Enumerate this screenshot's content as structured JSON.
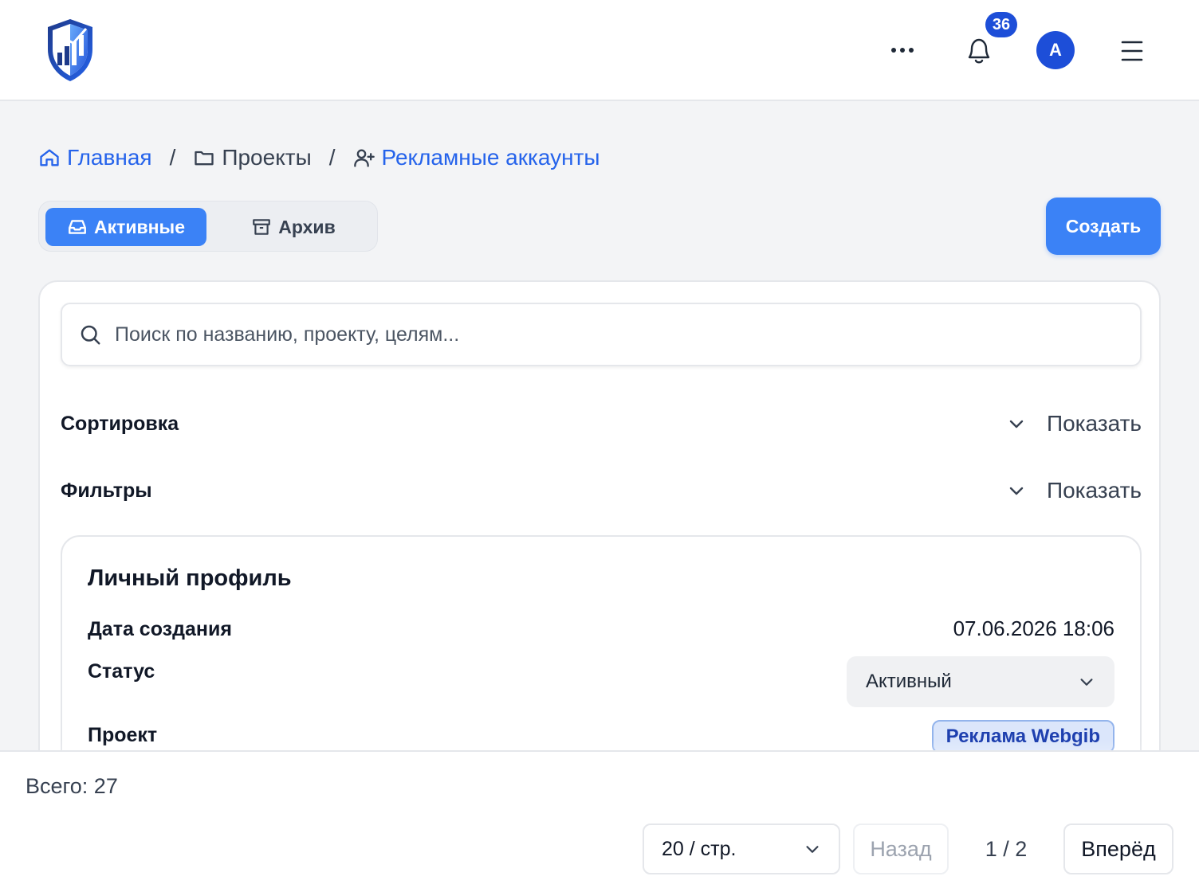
{
  "header": {
    "notifications_count": "36",
    "avatar_initial": "A",
    "logo_icon": "shield-chart-logo",
    "icons": [
      "more-icon",
      "bell-icon",
      "hamburger-icon"
    ]
  },
  "breadcrumb": {
    "items": [
      {
        "label": "Главная",
        "icon": "home-icon"
      },
      {
        "label": "Проекты",
        "icon": "folder-icon"
      },
      {
        "label": "Рекламные аккаунты",
        "icon": "user-plus-icon"
      }
    ],
    "separator": "/"
  },
  "tabs": {
    "active_label": "Активные",
    "archive_label": "Архив"
  },
  "create_label": "Создать",
  "search": {
    "placeholder": "Поиск по названию, проекту, целям..."
  },
  "sections": {
    "sort_label": "Сортировка",
    "filters_label": "Фильтры",
    "show_label": "Показать"
  },
  "item": {
    "title": "Личный профиль",
    "created_label": "Дата создания",
    "created_value": "07.06.2026 18:06",
    "status_label": "Статус",
    "status_value": "Активный",
    "project_label": "Проект",
    "project_value": "Реклама Webgib"
  },
  "footer": {
    "total": "Всего: 27",
    "per_page": "20 / стр.",
    "prev_label": "Назад",
    "page_indicator": "1 / 2",
    "next_label": "Вперёд"
  },
  "colors": {
    "accent": "#3b82f6",
    "brand_dark": "#1d4ed8",
    "background": "#f3f4f6",
    "link": "#2563eb"
  }
}
